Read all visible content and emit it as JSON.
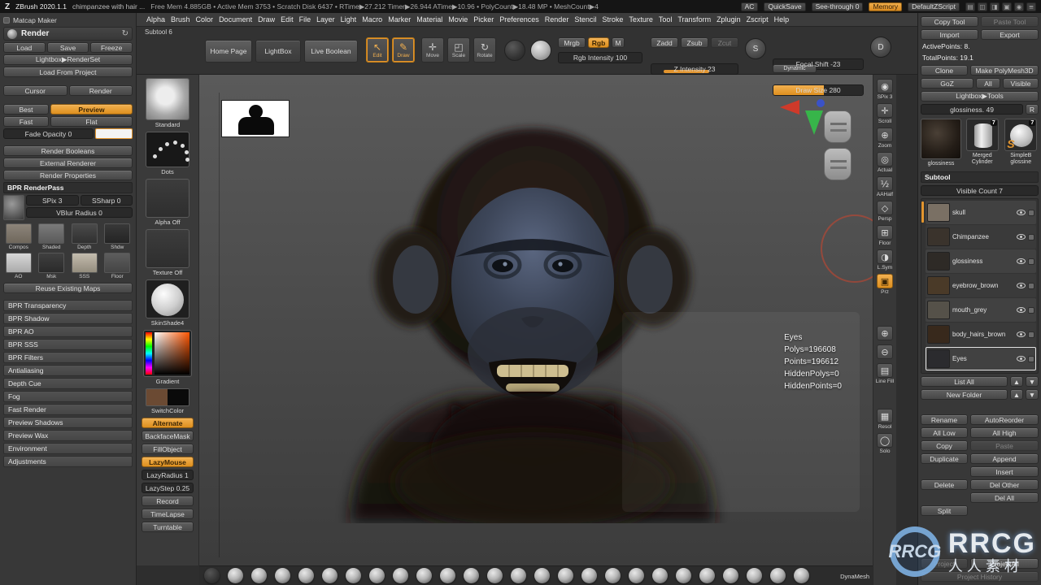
{
  "colors": {
    "accent_orange": "#e2952f",
    "watermark_blue": "#80b2e6",
    "panel_bg": "#383838"
  },
  "icons": {
    "zlogo": "Z",
    "refresh": "↻",
    "edit": "↖",
    "draw": "✎",
    "move": "✛",
    "scale": "◰",
    "rotate": "↻",
    "stroke_knob": "S",
    "dynamic_knob": "D",
    "up": "▲",
    "down": "▼",
    "titlebar_icons": [
      {
        "glyph": "▤",
        "name": "palette-grid-icon"
      },
      {
        "glyph": "◫",
        "name": "split-view-icon"
      },
      {
        "glyph": "◨",
        "name": "shade-view-icon"
      },
      {
        "glyph": "▣",
        "name": "stencil-icon"
      },
      {
        "glyph": "◉",
        "name": "record-icon"
      },
      {
        "glyph": "≡",
        "name": "menu-icon"
      }
    ]
  },
  "titlebar": {
    "app_title": "ZBrush 2020.1.1",
    "doc_title": "chimpanzee with hair ...",
    "stats": "Free Mem 4.885GB • Active Mem 3753 • Scratch Disk 6437 • RTime▶27.212 Timer▶26.944 ATime▶10.96 • PolyCount▶18.48 MP • MeshCount▶4",
    "ac": "AC",
    "quicksave": "QuickSave",
    "see_through": "See-through 0",
    "memory": "Memory",
    "default_zscript": "DefaultZScript"
  },
  "menubar": {
    "items": [
      "Alpha",
      "Brush",
      "Color",
      "Document",
      "Draw",
      "Edit",
      "File",
      "Layer",
      "Light",
      "Macro",
      "Marker",
      "Material",
      "Movie",
      "Picker",
      "Preferences",
      "Render",
      "Stencil",
      "Stroke",
      "Texture",
      "Tool",
      "Transform",
      "Zplugin",
      "Zscript",
      "Help"
    ]
  },
  "toolbar": {
    "subtool_caption": "Subtool 6",
    "home_page": "Home Page",
    "lightbox": "LightBox",
    "live_boolean": "Live Boolean",
    "edit": "Edit",
    "draw": "Draw",
    "move": "Move",
    "scale": "Scale",
    "rotate": "Rotate",
    "mrgb": "Mrgb",
    "rgb": "Rgb",
    "m": "M",
    "rgb_intensity": "Rgb Intensity 100",
    "zadd": "Zadd",
    "zsub": "Zsub",
    "zcut": "Zcut",
    "z_intensity": "Z Intensity 23",
    "focal_shift": "Focal Shift -23",
    "draw_size": "Draw Size 280",
    "dynamic": "Dynamic"
  },
  "render_panel": {
    "palette_caption": "Matcap Maker",
    "title": "Render",
    "load": "Load",
    "save": "Save",
    "freeze": "Freeze",
    "lightbox_renderset": "Lightbox▶RenderSet",
    "load_from_project": "Load From Project",
    "cursor": "Cursor",
    "render_mode": "Render",
    "best": "Best",
    "preview": "Preview",
    "fast": "Fast",
    "flat": "Flat",
    "fade_opacity": "Fade Opacity 0",
    "render_booleans": "Render Booleans",
    "external_renderer": "External Renderer",
    "render_properties": "Render Properties",
    "bpr_renderpass": "BPR RenderPass",
    "spix": "SPix 3",
    "ssharp": "SSharp 0",
    "vblur": "VBlur Radius 0",
    "pass_thumbs": [
      "Compos",
      "Shaded",
      "Depth",
      "Shdw",
      "AO",
      "Msk",
      "SSS",
      "Floor"
    ],
    "reuse_maps": "Reuse Existing Maps",
    "sections": [
      "BPR Transparency",
      "BPR Shadow",
      "BPR AO",
      "BPR SSS",
      "BPR Filters",
      "Antialiasing",
      "Depth Cue",
      "Fog",
      "Fast Render",
      "Preview Shadows",
      "Preview Wax",
      "Environment",
      "Adjustments"
    ]
  },
  "tool_shelf": {
    "brush": "Standard",
    "stroke": "Dots",
    "alpha": "Alpha Off",
    "texture": "Texture Off",
    "material": "SkinShade4",
    "gradient": "Gradient",
    "switchcolor": "SwitchColor",
    "alternate": "Alternate",
    "backface_mask": "BackfaceMask",
    "fill_object": "FillObject",
    "lazy_mouse": "LazyMouse",
    "lazy_radius": "LazyRadius 1",
    "lazy_step": "LazyStep 0.25",
    "record": "Record",
    "timelapse": "TimeLapse",
    "turntable": "Turntable"
  },
  "canvas": {
    "stats_lines": [
      "Eyes",
      "Polys=196608",
      "Points=196612",
      "HiddenPolys=0",
      "HiddenPoints=0"
    ]
  },
  "view_strip": {
    "items": [
      {
        "label": "SPix 3",
        "glyph": "◉",
        "name": "bpr-render-icon"
      },
      {
        "label": "Scroll",
        "glyph": "✛",
        "name": "scroll-icon"
      },
      {
        "label": "Zoom",
        "glyph": "⊕",
        "name": "zoom-icon"
      },
      {
        "label": "Actual",
        "glyph": "◎",
        "name": "actual-size-icon"
      },
      {
        "label": "AAHalf",
        "glyph": "½",
        "name": "aahalf-icon"
      },
      {
        "label": "Persp",
        "glyph": "◇",
        "name": "perspective-icon"
      },
      {
        "label": "Floor",
        "glyph": "⊞",
        "name": "floor-grid-icon"
      },
      {
        "label": "L.Sym",
        "glyph": "◑",
        "name": "local-symmetry-icon"
      },
      {
        "label": "Prz",
        "glyph": "▣",
        "name": "prz-icon",
        "active": true
      },
      {
        "label": "",
        "glyph": "⊕",
        "name": "zoom-in-icon"
      },
      {
        "label": "",
        "glyph": "⊖",
        "name": "zoom-out-icon"
      },
      {
        "label": "Line Fill",
        "glyph": "▤",
        "name": "line-fill-icon"
      },
      {
        "label": "Resol",
        "glyph": "▦",
        "name": "resolution-icon"
      },
      {
        "label": "Solo",
        "glyph": "◯",
        "name": "solo-icon"
      }
    ]
  },
  "tool_panel": {
    "copy_tool": "Copy Tool",
    "paste_tool": "Paste Tool",
    "import": "Import",
    "export": "Export",
    "active_points": "ActivePoints: 8.",
    "total_points": "TotalPoints: 19.1",
    "clone": "Clone",
    "make_polymesh": "Make PolyMesh3D",
    "goz": "GoZ",
    "all": "All",
    "visible": "Visible",
    "lightbox_tools": "Lightbox▶Tools",
    "tool_slider": "glossiness. 49",
    "r_button": "R",
    "active_tool_label": "glossiness",
    "recent1": "Merged Cylinder",
    "recent1_badge": "7",
    "recent2": "SimpleB glossine",
    "recent2_badge": "7",
    "recent2_icon": "S",
    "subtool_title": "Subtool",
    "visible_count": "Visible Count 7",
    "subtools": [
      {
        "name": "skull",
        "color": "#7a7064",
        "selected": false
      },
      {
        "name": "Chimpanzee",
        "color": "#3a332c",
        "selected": false
      },
      {
        "name": "glossiness",
        "color": "#2e2a26",
        "selected": false
      },
      {
        "name": "eyebrow_brown",
        "color": "#4a3a28",
        "selected": false
      },
      {
        "name": "mouth_grey",
        "color": "#555149",
        "selected": false
      },
      {
        "name": "body_hairs_brown",
        "color": "#38291c",
        "selected": false
      },
      {
        "name": "Eyes",
        "color": "#2b2b2e",
        "selected": true
      }
    ],
    "list_all": "List All",
    "new_folder": "New Folder",
    "rename": "Rename",
    "autoreorder": "AutoReorder",
    "all_low": "All Low",
    "all_high": "All High",
    "copy": "Copy",
    "paste": "Paste",
    "duplicate": "Duplicate",
    "append": "Append",
    "insert": "Insert",
    "delete": "Delete",
    "del_other": "Del Other",
    "del_all": "Del All",
    "split": "Split",
    "project": "Project",
    "project_all": "ProjectAll",
    "project_history": "Project History"
  },
  "bottom_bar": {
    "sphere_count": 26,
    "dynamesh": "DynaMesh"
  },
  "watermark": {
    "line1": "RRCG",
    "line2": "人人素材"
  }
}
